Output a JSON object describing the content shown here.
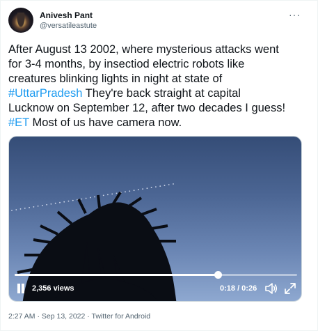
{
  "author": {
    "name": "Anivesh Pant",
    "handle": "@versatileastute"
  },
  "more_menu": "···",
  "tweet": {
    "line1": "After August 13 2002, where mysterious attacks went",
    "line2": "for 3-4 months, by insectiod electric robots like",
    "line3": "creatures blinking lights in night at state of",
    "hashtag1": "#UttarPradesh",
    "line4_rest": " They're back straight at capital",
    "line5": "Lucknow on September 12, after two decades I guess!",
    "hashtag2": "#ET",
    "line6_rest": " Most of us have camera now."
  },
  "video": {
    "views": "2,356 views",
    "time": "0:18 / 0:26",
    "progress": 0.72
  },
  "meta": {
    "time": "2:27 AM",
    "sep1": " · ",
    "date": "Sep 13, 2022",
    "sep2": " · ",
    "source": "Twitter for Android"
  }
}
